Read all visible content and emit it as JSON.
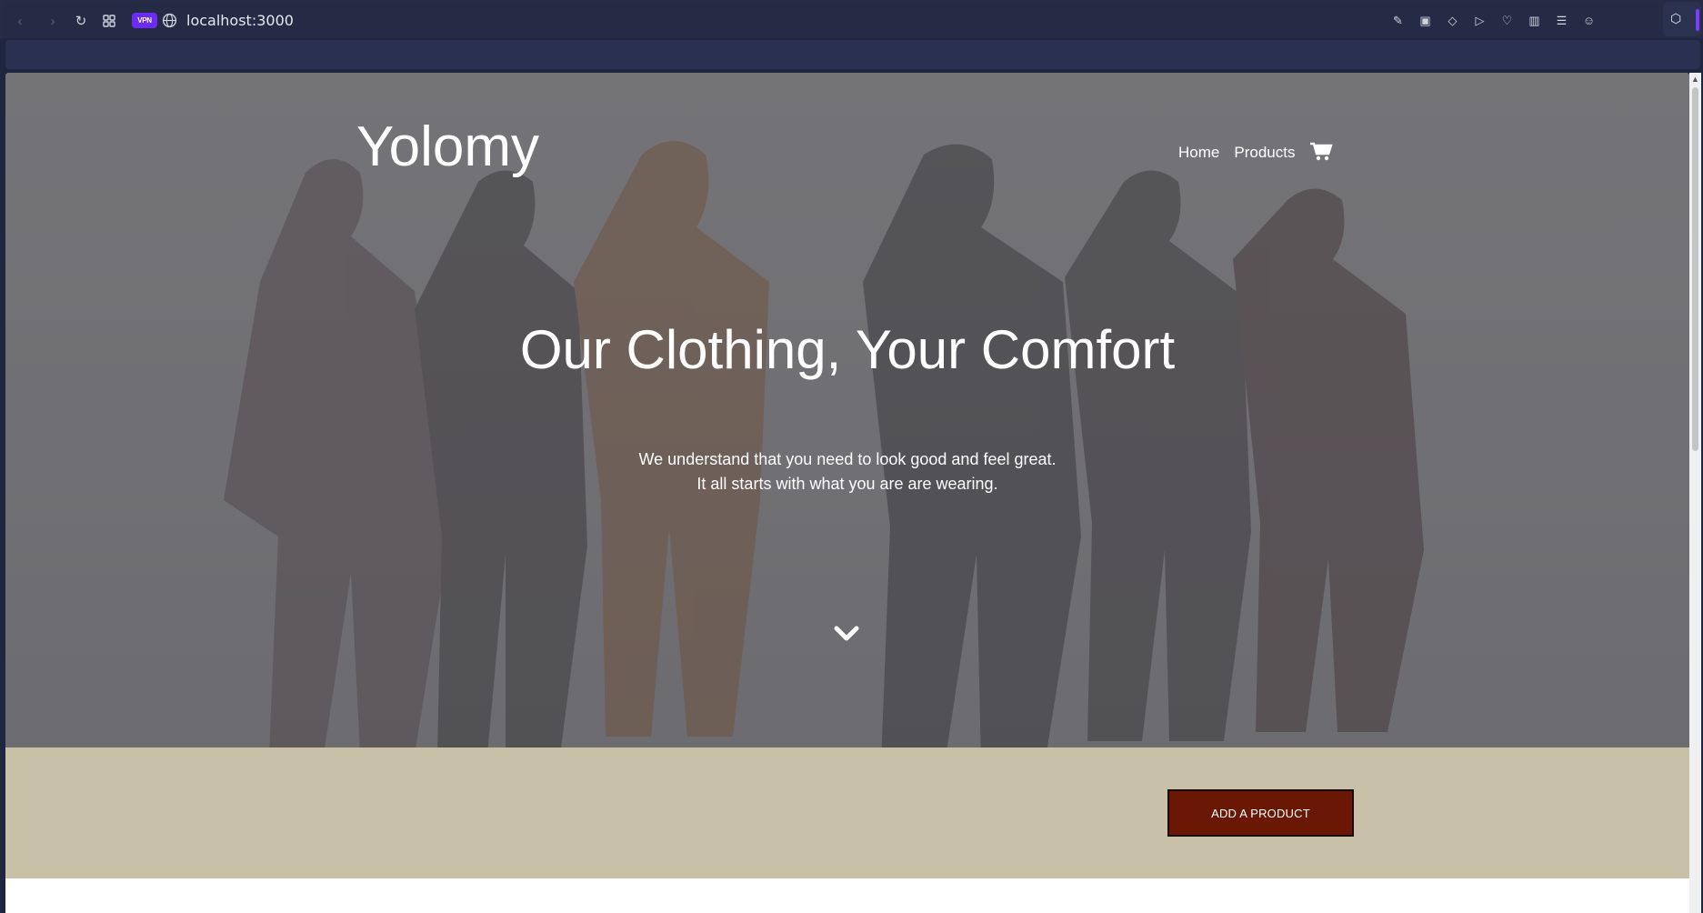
{
  "browser": {
    "vpn_label": "VPN",
    "url": "localhost:3000"
  },
  "site": {
    "brand": "Yolomy",
    "nav": {
      "home": "Home",
      "products": "Products"
    },
    "hero": {
      "headline": "Our Clothing, Your Comfort",
      "sub_line1": "We understand that you need to look good and feel great.",
      "sub_line2": "It all starts with what you are are wearing."
    },
    "cta": {
      "add_product": "ADD A PRODUCT"
    }
  },
  "colors": {
    "cta_background": "#6b1706",
    "band_background": "#c8c0a7",
    "vpn_badge": "#6b2cf5"
  },
  "icons": [
    "back-icon",
    "forward-icon",
    "reload-icon",
    "tabs-grid-icon",
    "globe-icon",
    "cart-icon",
    "chevron-down-icon"
  ]
}
